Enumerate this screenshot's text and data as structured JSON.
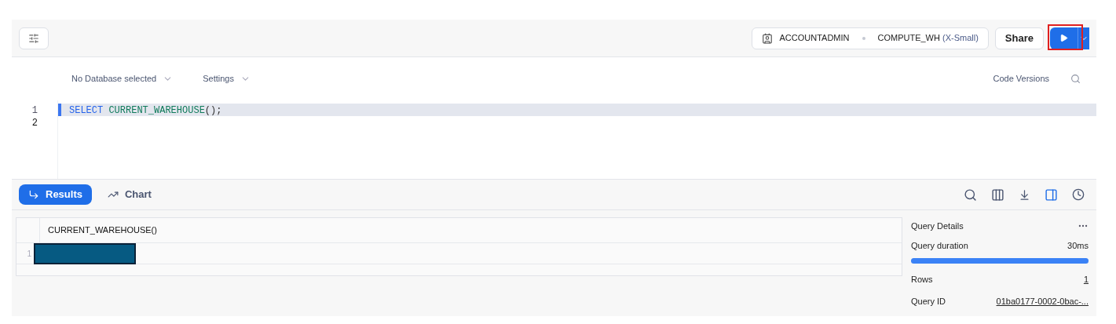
{
  "toolbar": {
    "role": "ACCOUNTADMIN",
    "warehouse": "COMPUTE_WH",
    "warehouse_size": "(X-Small)",
    "share": "Share",
    "run_highlighted": true
  },
  "editor_header": {
    "database": "No Database selected",
    "settings": "Settings",
    "code_versions": "Code Versions"
  },
  "code": [
    {
      "number": "1",
      "current": true,
      "tokens": [
        {
          "kind": "keyword",
          "text": "SELECT"
        },
        {
          "kind": "function",
          "text": "CURRENT_WAREHOUSE"
        },
        {
          "kind": "punct",
          "text": "();"
        }
      ]
    },
    {
      "number": "2",
      "current": false
    }
  ],
  "result_tabs": [
    {
      "label": "Results",
      "kind": "results",
      "selected": true
    },
    {
      "label": "Chart",
      "kind": "chart",
      "selected": false
    }
  ],
  "table": {
    "columns": [
      "CURRENT_WAREHOUSE()"
    ],
    "rows": [
      {
        "number": "1",
        "redacted": true
      }
    ]
  },
  "details": {
    "title": "Query Details",
    "duration_label": "Query duration",
    "duration": "30ms",
    "level": 1,
    "rows_label": "Rows",
    "rows": "1",
    "id_label": "Query ID",
    "id": "01ba0177-0002-0bac-..."
  }
}
